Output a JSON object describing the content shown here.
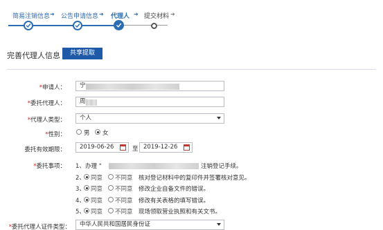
{
  "steps": [
    {
      "label": "简易注销信息",
      "state": "done"
    },
    {
      "label": "公告申请信息",
      "state": "done"
    },
    {
      "label": "代理人",
      "state": "current"
    },
    {
      "label": "提交材料",
      "state": "pending"
    }
  ],
  "step_arrow": "➜",
  "section": {
    "title": "完善代理人信息",
    "share_button": "共享提取"
  },
  "form": {
    "applicant": {
      "label": "申请人：",
      "value_visible": "宁"
    },
    "agent": {
      "label": "委托代理人：",
      "value_visible": "周"
    },
    "agent_type": {
      "label": "代理人类型：",
      "value": "个人"
    },
    "gender": {
      "label": "性别：",
      "male": "男",
      "female": "女",
      "selected": "女"
    },
    "validity": {
      "label": "委托有效期限：",
      "start": "2019-06-26",
      "separator": "至",
      "end": "2019-12-26"
    },
    "matters": {
      "label": "委托事项：",
      "items": [
        {
          "num": "1、",
          "prefix": "办理 \"",
          "suffix": "注销登记手续。"
        },
        {
          "num": "2、",
          "agree": "同意",
          "disagree": "不同意",
          "text": "核对登记材料中的复印件并签署核对意见。"
        },
        {
          "num": "3、",
          "agree": "同意",
          "disagree": "不同意",
          "text": "修改企业自备文件的错误。"
        },
        {
          "num": "4、",
          "agree": "同意",
          "disagree": "不同意",
          "text": "修改有关表格的填写错误。"
        },
        {
          "num": "5、",
          "agree": "同意",
          "disagree": "不同意",
          "text": "现场领取营业执照和有关文书。"
        }
      ]
    },
    "id_type": {
      "label": "委托代理人证件类型：",
      "value": "中华人民共和国居民身份证"
    }
  },
  "required_mark": "*",
  "colors": {
    "accent": "#2b6db4",
    "button": "#1e5aa8",
    "required": "#d0211c"
  }
}
